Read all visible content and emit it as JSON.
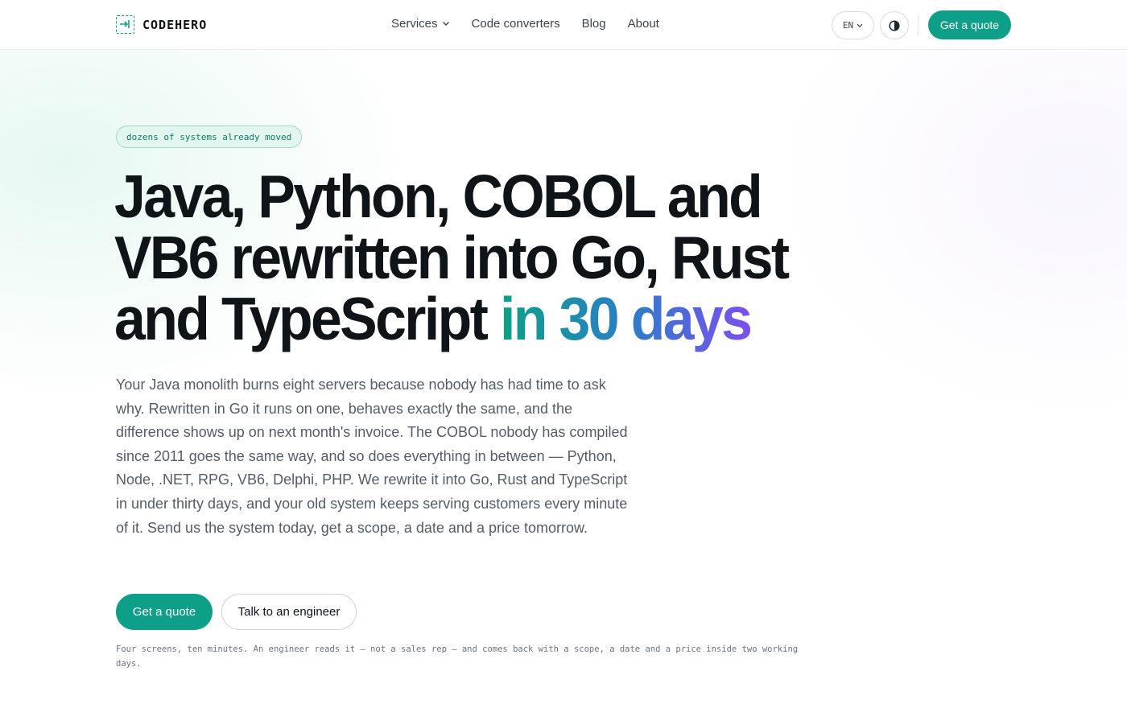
{
  "brand": {
    "name": "CODEHERO",
    "logo_icon": "dashed-box-arrow-icon",
    "accent_color": "#0d9f87"
  },
  "nav": {
    "items": [
      {
        "label": "Services",
        "has_dropdown": true
      },
      {
        "label": "Code converters"
      },
      {
        "label": "Blog"
      },
      {
        "label": "About"
      }
    ],
    "language": "EN",
    "theme_toggle_icon": "contrast-icon",
    "cta_label": "Get a quote"
  },
  "hero": {
    "badge": "dozens of systems already moved",
    "headline_main": "Java, Python, COBOL and VB6 rewritten into Go, Rust and TypeScript ",
    "headline_highlight": "in 30 days",
    "lead": "Your Java monolith burns eight servers because nobody has had time to ask why. Rewritten in Go it runs on one, behaves exactly the same, and the difference shows up on next month's invoice. The COBOL nobody has compiled since 2011 goes the same way, and so does everything in between — Python, Node, .NET, RPG, VB6, Delphi, PHP. We rewrite it into Go, Rust and TypeScript in under thirty days, and your old system keeps serving customers every minute of it. Send us the system today, get a scope, a date and a price tomorrow.",
    "primary_cta": "Get a quote",
    "secondary_cta": "Talk to an engineer",
    "note": "Four screens, ten minutes. An engineer reads it — not a sales rep — and comes back with a scope, a date and a price inside two working days."
  },
  "colors": {
    "accent": "#0d9f87",
    "gradient_start": "#0d9f87",
    "gradient_end": "#7c4ff0"
  }
}
